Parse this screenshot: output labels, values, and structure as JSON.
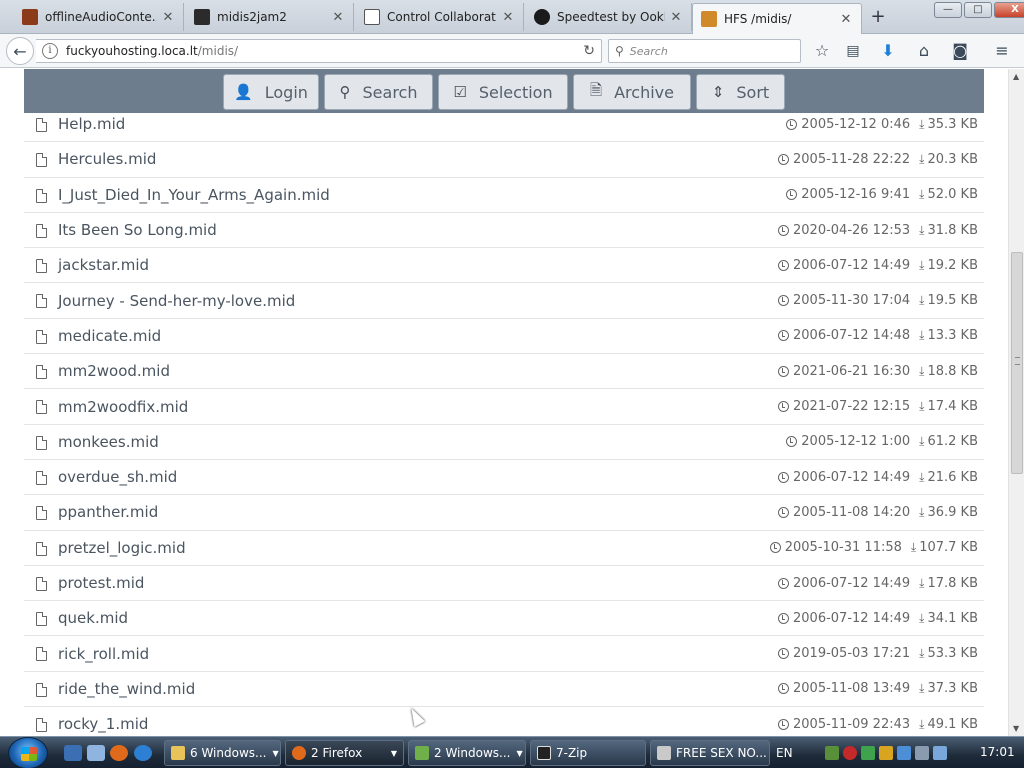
{
  "tabs": [
    {
      "label": "offlineAudioConte...",
      "color": "#8b3a1a"
    },
    {
      "label": "midis2jam2",
      "color": "#2b2b2b"
    },
    {
      "label": "Control Collaborati...",
      "color": "#555555"
    },
    {
      "label": "Speedtest by Ookla...",
      "color": "#1a1a1a"
    },
    {
      "label": "HFS /midis/",
      "color": "#d08a2a"
    }
  ],
  "window_buttons": {
    "min": "—",
    "max": "□",
    "close": "X"
  },
  "address": {
    "host": "fuckyouhosting.loca.lt",
    "path": "/midis/"
  },
  "search": {
    "placeholder": "Search"
  },
  "toolbar": {
    "login": "Login",
    "search": "Search",
    "selection": "Selection",
    "archive": "Archive",
    "sort": "Sort"
  },
  "files": [
    {
      "name": "Help.mid",
      "date": "2005-12-12 0:46",
      "size": "35.3 KB"
    },
    {
      "name": "Hercules.mid",
      "date": "2005-11-28 22:22",
      "size": "20.3 KB"
    },
    {
      "name": "I_Just_Died_In_Your_Arms_Again.mid",
      "date": "2005-12-16 9:41",
      "size": "52.0 KB"
    },
    {
      "name": "Its Been So Long.mid",
      "date": "2020-04-26 12:53",
      "size": "31.8 KB"
    },
    {
      "name": "jackstar.mid",
      "date": "2006-07-12 14:49",
      "size": "19.2 KB"
    },
    {
      "name": "Journey - Send-her-my-love.mid",
      "date": "2005-11-30 17:04",
      "size": "19.5 KB"
    },
    {
      "name": "medicate.mid",
      "date": "2006-07-12 14:48",
      "size": "13.3 KB"
    },
    {
      "name": "mm2wood.mid",
      "date": "2021-06-21 16:30",
      "size": "18.8 KB"
    },
    {
      "name": "mm2woodfix.mid",
      "date": "2021-07-22 12:15",
      "size": "17.4 KB"
    },
    {
      "name": "monkees.mid",
      "date": "2005-12-12 1:00",
      "size": "61.2 KB"
    },
    {
      "name": "overdue_sh.mid",
      "date": "2006-07-12 14:49",
      "size": "21.6 KB"
    },
    {
      "name": "ppanther.mid",
      "date": "2005-11-08 14:20",
      "size": "36.9 KB"
    },
    {
      "name": "pretzel_logic.mid",
      "date": "2005-10-31 11:58",
      "size": "107.7 KB"
    },
    {
      "name": "protest.mid",
      "date": "2006-07-12 14:49",
      "size": "17.8 KB"
    },
    {
      "name": "quek.mid",
      "date": "2006-07-12 14:49",
      "size": "34.1 KB"
    },
    {
      "name": "rick_roll.mid",
      "date": "2019-05-03 17:21",
      "size": "53.3 KB"
    },
    {
      "name": "ride_the_wind.mid",
      "date": "2005-11-08 13:49",
      "size": "37.3 KB"
    },
    {
      "name": "rocky_1.mid",
      "date": "2005-11-09 22:43",
      "size": "49.1 KB"
    }
  ],
  "taskbar": {
    "tasks": [
      {
        "label": "6 Windows...",
        "color": "#e8c35a"
      },
      {
        "label": "2 Firefox",
        "color": "#e06a1b"
      },
      {
        "label": "2 Windows...",
        "color": "#6fb04a"
      },
      {
        "label": "7-Zip",
        "color": "#222222"
      },
      {
        "label": "FREE SEX NO...",
        "color": "#c9c9c9"
      }
    ],
    "lang": "EN",
    "time": "17:01"
  }
}
